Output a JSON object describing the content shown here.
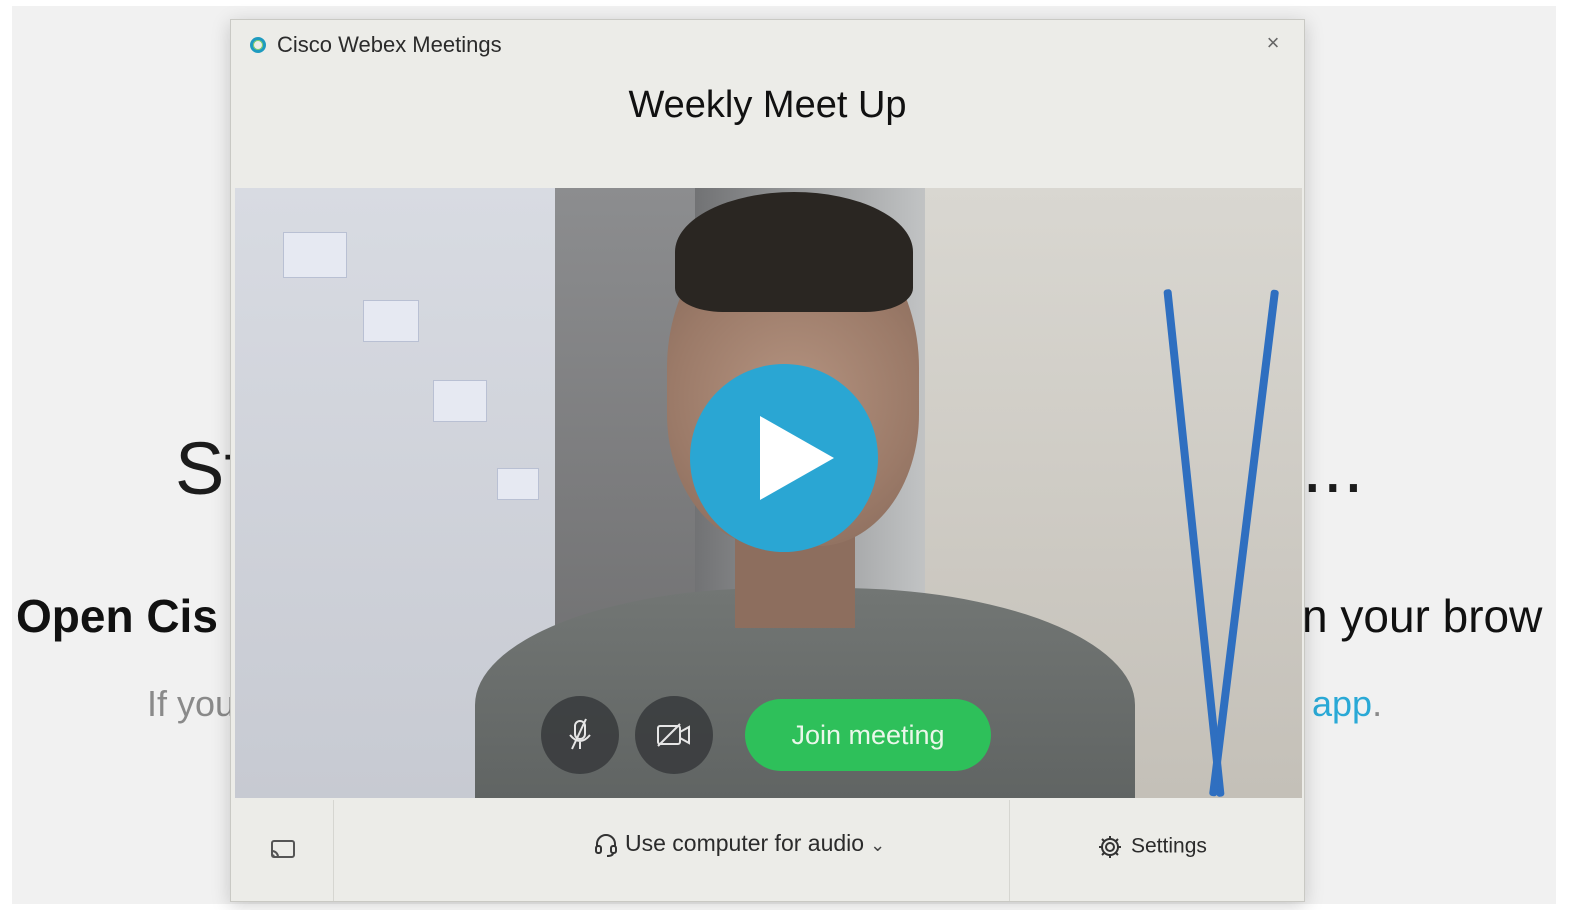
{
  "background_page": {
    "heading_left": "St",
    "heading_right": "...",
    "subheading_left": "Open Cis",
    "subheading_right": "n your brow",
    "line_left": "If you",
    "line_link": "app",
    "line_end": "."
  },
  "dialog": {
    "app_name": "Cisco Webex Meetings",
    "close_symbol": "×",
    "meeting_title": "Weekly Meet Up",
    "join_label": "Join meeting",
    "audio_option": "Use computer for audio",
    "chevron": "⌄",
    "settings_label": "Settings"
  },
  "colors": {
    "play_button": "#2aa6d3",
    "join_button": "#2ec05a",
    "link": "#2aa9d6",
    "brand_logo": "#1e9bbf"
  },
  "icons": [
    "webex-logo-icon",
    "close-icon",
    "play-icon",
    "mute-mic-icon",
    "video-off-icon",
    "cast-icon",
    "headset-icon",
    "chevron-down-icon",
    "gear-icon"
  ]
}
